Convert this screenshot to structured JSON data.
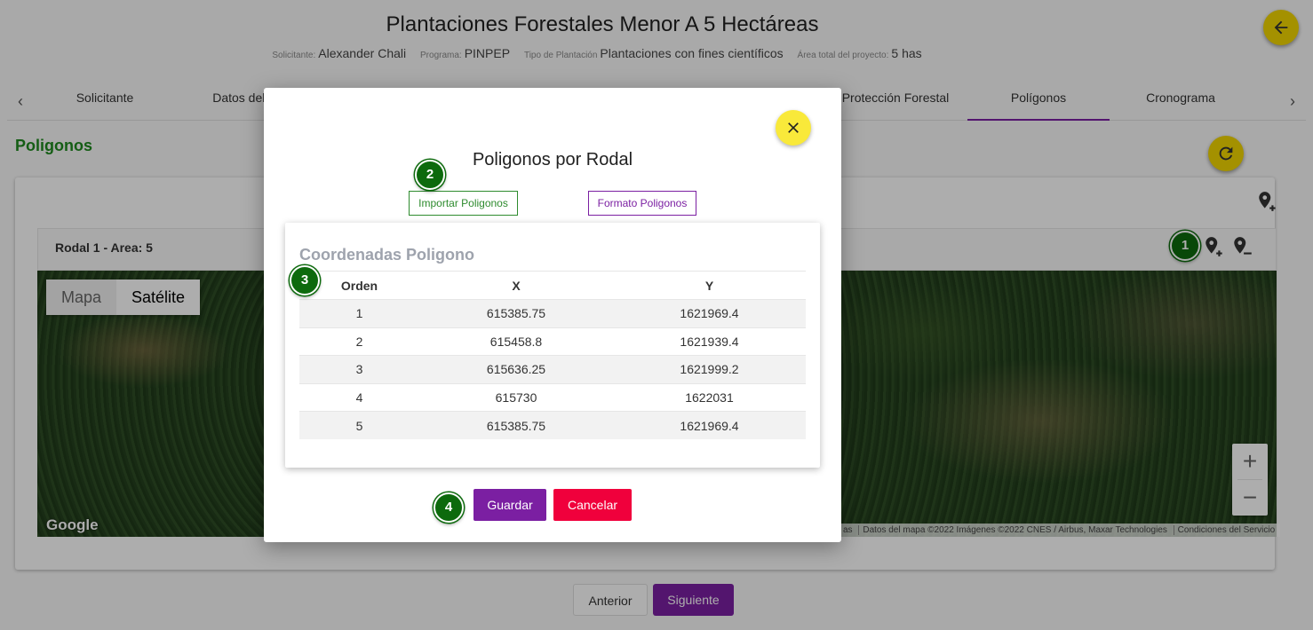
{
  "page": {
    "title": "Plantaciones Forestales Menor A 5 Hectáreas",
    "meta": [
      {
        "label": "Solicitante:",
        "value": "Alexander Chali"
      },
      {
        "label": "Programa:",
        "value": "PINPEP"
      },
      {
        "label": "Tipo de Plantación",
        "value": "Plantaciones con fines científicos"
      },
      {
        "label": "Área total del proyecto:",
        "value": "5 has"
      }
    ]
  },
  "tabs": [
    {
      "label": "Solicitante"
    },
    {
      "label": "Datos del Te"
    },
    {
      "label": "Protección Forestal"
    },
    {
      "label": "Polígonos"
    },
    {
      "label": "Cronograma"
    }
  ],
  "section": {
    "title": "Poligonos"
  },
  "rodal": {
    "label": "Rodal 1 - Area: 5"
  },
  "map": {
    "type_map": "Mapa",
    "type_satellite": "Satélite",
    "logo": "Google",
    "attribution_cut": "as",
    "attribution": "Datos del mapa ©2022 Imágenes ©2022 CNES / Airbus, Maxar Technologies",
    "terms": "Condiciones del Servicio",
    "zoom_in": "+",
    "zoom_out": "−"
  },
  "footer": {
    "prev": "Anterior",
    "next": "Siguiente"
  },
  "modal": {
    "title": "Poligonos por Rodal",
    "import_label": "Importar Poligonos",
    "format_label": "Formato Poligonos",
    "card_title": "Coordenadas Poligono",
    "columns": [
      "Orden",
      "X",
      "Y"
    ],
    "rows": [
      {
        "orden": "1",
        "x": "615385.75",
        "y": "1621969.4"
      },
      {
        "orden": "2",
        "x": "615458.8",
        "y": "1621939.4"
      },
      {
        "orden": "3",
        "x": "615636.25",
        "y": "1621999.2"
      },
      {
        "orden": "4",
        "x": "615730",
        "y": "1622031"
      },
      {
        "orden": "5",
        "x": "615385.75",
        "y": "1621969.4"
      }
    ],
    "save_label": "Guardar",
    "cancel_label": "Cancelar"
  },
  "badges": [
    "1",
    "2",
    "3",
    "4"
  ],
  "colors": {
    "accent_yellow": "#f2d600",
    "primary_purple": "#7b1fa2",
    "success_green": "#1e8a1e",
    "danger_red": "#f0003c",
    "badge_green": "#0d6a0d"
  },
  "icons": {
    "back": "arrow-left-icon",
    "refresh": "refresh-icon",
    "close": "close-icon",
    "add_marker": "map-marker-plus-icon",
    "remove_marker": "map-marker-minus-icon",
    "tab_prev": "chevron-left-icon",
    "tab_next": "chevron-right-icon"
  }
}
